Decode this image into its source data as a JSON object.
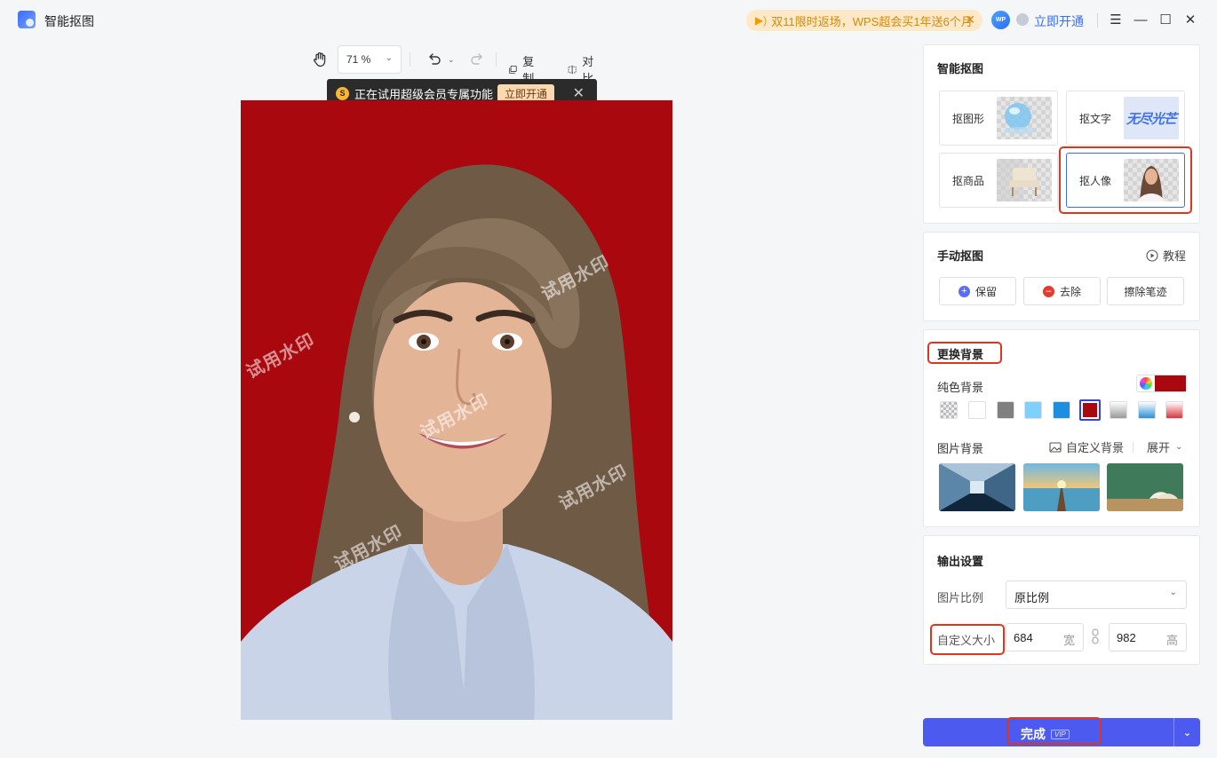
{
  "app": {
    "title": "智能抠图"
  },
  "promo": {
    "text": "双11限时返场，WPS超会买1年送6个月"
  },
  "titlebar": {
    "avatar_text": "WP",
    "open_label": "立即开通"
  },
  "toolbar": {
    "zoom": "71 %",
    "copy_label": "复制",
    "compare_label": "对比"
  },
  "trial": {
    "text": "正在试用超级会员专属功能",
    "button": "立即开通"
  },
  "canvas": {
    "watermark": "试用水印",
    "background_color": "#a9080e"
  },
  "smart": {
    "title": "智能抠图",
    "cards": [
      {
        "label": "抠图形",
        "icon": "glass-sphere-icon"
      },
      {
        "label": "抠文字",
        "thumb_text": "无尽光芒"
      },
      {
        "label": "抠商品",
        "icon": "armchair-icon"
      },
      {
        "label": "抠人像",
        "icon": "portrait-icon",
        "selected": true
      }
    ]
  },
  "manual": {
    "title": "手动抠图",
    "tutorial": "教程",
    "keep": "保留",
    "remove": "去除",
    "erase": "擦除笔迹"
  },
  "background": {
    "title": "更换背景",
    "solid_label": "纯色背景",
    "current_color": "#a9080e",
    "swatches": [
      "transparent",
      "#ffffff",
      "#808080",
      "#7fd0ff",
      "#1e8ee0",
      "#a9080e",
      "gradient-gray",
      "gradient-blue",
      "gradient-red"
    ],
    "selected_swatch": 5,
    "image_label": "图片背景",
    "custom_label": "自定义背景",
    "expand_label": "展开",
    "images": [
      "glass-building",
      "lake-pier-sunset",
      "green-chalkboard-books"
    ]
  },
  "output": {
    "title": "输出设置",
    "ratio_label": "图片比例",
    "ratio_value": "原比例",
    "size_label": "自定义大小",
    "width": "684",
    "width_unit": "宽",
    "height": "982",
    "height_unit": "高"
  },
  "done": {
    "label": "完成",
    "badge": "VIP"
  }
}
